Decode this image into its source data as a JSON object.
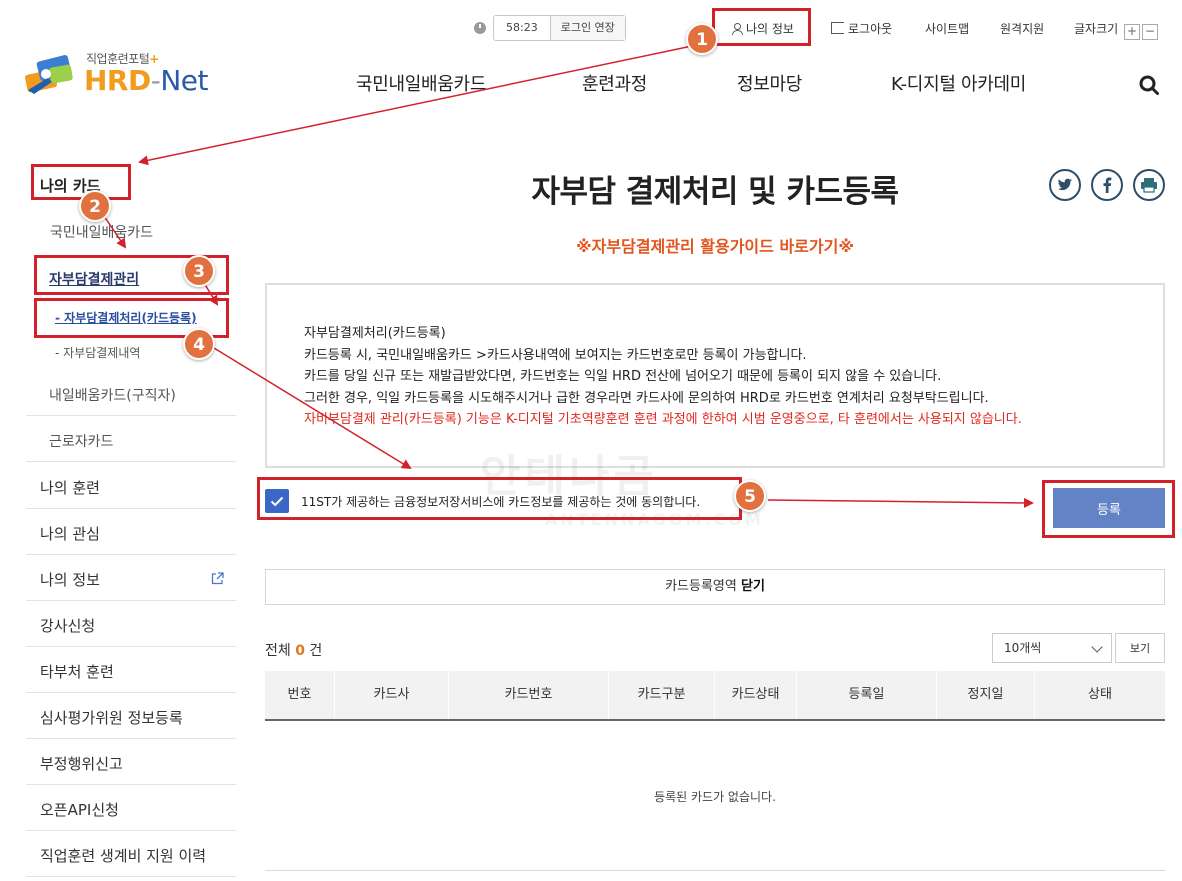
{
  "logo": {
    "subtitle": "직업훈련포털",
    "plus": "+",
    "hrd": "HRD",
    "dash": "-",
    "net": "Net"
  },
  "header": {
    "timer": "58:23",
    "extend_login": "로그인 연장",
    "my_info": "나의 정보",
    "logout": "로그아웃",
    "sitemap": "사이트맵",
    "remote_support": "원격지원",
    "font_size": "글자크기",
    "font_plus": "+",
    "font_minus": "−"
  },
  "gnb": [
    "국민내일배움카드",
    "훈련과정",
    "정보마당",
    "K-디지털 아카데미"
  ],
  "sidebar": {
    "title": "나의 카드",
    "sub1": "국민내일배움카드",
    "sub2": "자부담결제관리",
    "sub2_children": [
      "- 자부담결제처리(카드등록)",
      "- 자부담결제내역"
    ],
    "sub3": "내일배움카드(구직자)",
    "sub4": "근로자카드",
    "main_items": [
      "나의 훈련",
      "나의 관심",
      "나의 정보",
      "강사신청",
      "타부처 훈련",
      "심사평가위원 정보등록",
      "부정행위신고",
      "오픈API신청",
      "직업훈련 생계비 지원 이력"
    ]
  },
  "main": {
    "title": "자부담 결제처리 및 카드등록",
    "guide_link": "※자부담결제관리 활용가이드 바로가기※",
    "info_lines": [
      "자부담결제처리(카드등록)",
      "카드등록 시, 국민내일배움카드 >카드사용내역에 보여지는 카드번호로만 등록이 가능합니다.",
      "카드를 당일 신규 또는 재발급받았다면, 카드번호는 익일 HRD 전산에 넘어오기 때문에 등록이 되지 않을 수 있습니다.",
      "그러한 경우, 익일 카드등록을 시도해주시거나 급한 경우라면 카드사에 문의하여 HRD로 카드번호 연계처리 요청부탁드립니다."
    ],
    "info_warning": "자비부담결제 관리(카드등록) 기능은 K-디지털 기초역량훈련 훈련 과정에 한하여 시범 운영중으로, 타 훈련에서는 사용되지 않습니다.",
    "agree_label": "11ST가 제공하는 금융정보저장서비스에 카드정보를 제공하는 것에 동의합니다.",
    "agree_checked": true,
    "register_button": "등록",
    "card_area_label": "카드등록영역",
    "card_area_toggle": "닫기",
    "total_prefix": "전체",
    "total_count": "0",
    "total_suffix": "건",
    "page_size": "10개씩",
    "view_button": "보기",
    "table_headers": [
      "번호",
      "카드사",
      "카드번호",
      "카드구분",
      "카드상태",
      "등록일",
      "정지일",
      "상태"
    ],
    "empty_message": "등록된 카드가 없습니다."
  },
  "annotations": [
    "1",
    "2",
    "3",
    "4",
    "5"
  ],
  "watermark": {
    "main": "안테나곰",
    "sub": "ANTENNAGOM.COM"
  },
  "colors": {
    "accent_red": "#d3212c",
    "badge": "#e1713e",
    "primary_button": "#6483c6",
    "warning_text": "#e0281e",
    "guide_link": "#e0561e"
  }
}
